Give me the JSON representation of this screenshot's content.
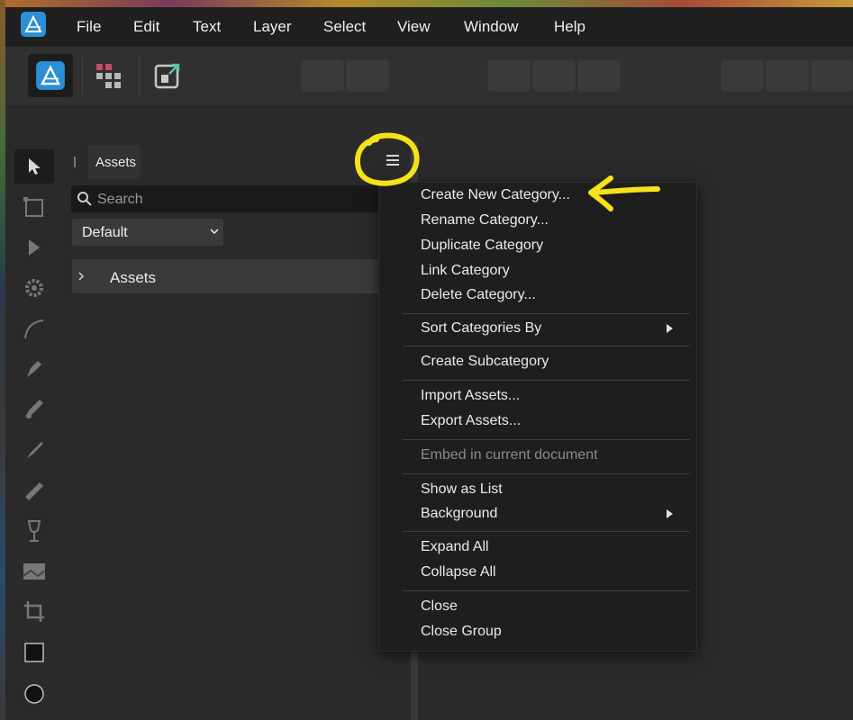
{
  "menubar": {
    "items": [
      "File",
      "Edit",
      "Text",
      "Layer",
      "Select",
      "View",
      "Window",
      "Help"
    ]
  },
  "panel": {
    "tab_label": "Assets",
    "search_placeholder": "Search",
    "dropdown_value": "Default",
    "category_row_label": "Assets"
  },
  "context_menu": {
    "create_new_category": "Create New Category...",
    "rename_category": "Rename Category...",
    "duplicate_category": "Duplicate Category",
    "link_category": "Link Category",
    "delete_category": "Delete Category...",
    "sort_categories_by": "Sort Categories By",
    "create_subcategory": "Create Subcategory",
    "import_assets": "Import Assets...",
    "export_assets": "Export Assets...",
    "embed_in_current_document": "Embed in current document",
    "show_as_list": "Show as List",
    "background": "Background",
    "expand_all": "Expand All",
    "collapse_all": "Collapse All",
    "close": "Close",
    "close_group": "Close Group"
  },
  "annotation": {
    "color": "#f5e21a"
  },
  "colors": {
    "accent": "#3a9bdc",
    "menu_bg": "#1e1e1e"
  }
}
